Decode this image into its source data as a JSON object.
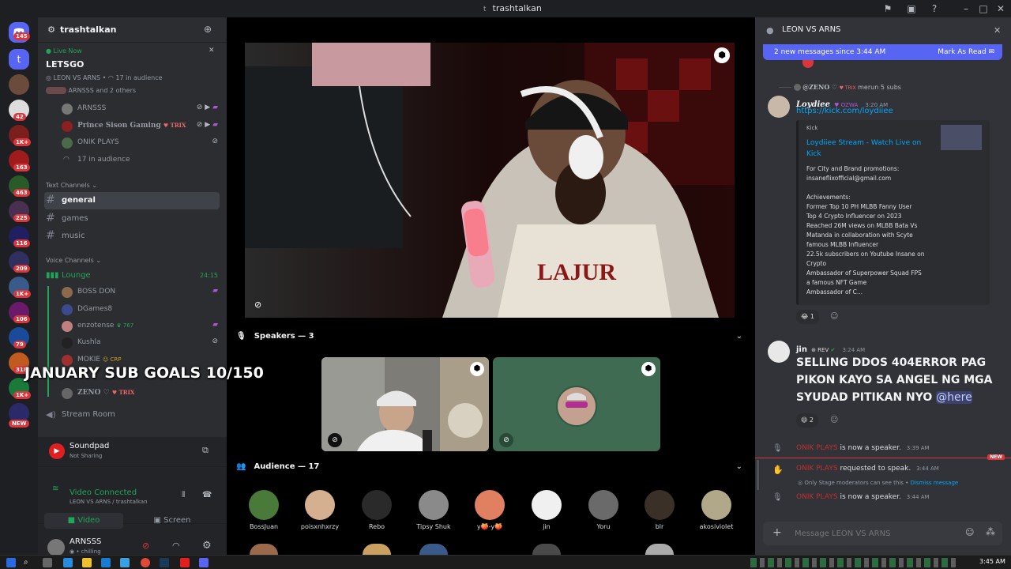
{
  "window": {
    "title": "trashtalkan",
    "title_icon": "t"
  },
  "rail": {
    "dm_badge": "145",
    "badges": [
      "42",
      "1K+",
      "163",
      "463",
      "225",
      "116",
      "209",
      "1K+",
      "106",
      "79",
      "318",
      "1K+"
    ],
    "new_label": "NEW"
  },
  "server": {
    "name": "trashtalkan",
    "live": {
      "live_label": "Live Now",
      "title": "LETSGO",
      "stage_name": "LEON VS ARNS",
      "audience": "17 in audience",
      "speakers_line": "ARNSSS and 2 others"
    },
    "stage_members": [
      {
        "name": "ARNSSS"
      },
      {
        "name": "Prince Sison Gaming",
        "tag": "TRIX"
      },
      {
        "name": "ONIK PLAYS"
      },
      {
        "name": "17 in audience"
      }
    ],
    "text_category": "Text Channels",
    "text_channels": [
      "general",
      "games",
      "music"
    ],
    "voice_category": "Voice Channels",
    "lounge": {
      "name": "Lounge",
      "timer": "24:15"
    },
    "lounge_members": [
      {
        "name": "BOSS DON"
      },
      {
        "name": "DGames8"
      },
      {
        "name": "enzotense",
        "tag": "767"
      },
      {
        "name": "Kushla"
      },
      {
        "name": "MOKIE",
        "tag": "CRP"
      },
      {
        "name": "ZENO",
        "tag": "TRIX"
      }
    ],
    "stream_room": "Stream Room",
    "overlay_goal": "JANUARY SUB GOALS 10/150"
  },
  "panel": {
    "soundpad_title": "Soundpad",
    "soundpad_status": "Not Sharing",
    "video_connected": "Video Connected",
    "video_sub": "LEON VS ARNS / trashtalkan",
    "video_btn": "Video",
    "screen_btn": "Screen",
    "user_name": "ARNSSS",
    "user_status": "chilling"
  },
  "stage": {
    "speakers_header": "Speakers — 3",
    "audience_header": "Audience — 17",
    "audience": [
      "BossJuan",
      "poisxnhxrzy",
      "Rebo",
      "Tipsy Shuk",
      "y🍑-y🍑",
      "jin",
      "Yoru",
      "blr",
      "akosiviolet"
    ]
  },
  "chat": {
    "title": "LEON VS ARNS",
    "new_messages": "2 new messages since 3:44 AM",
    "mark_read": "Mark As Read",
    "reply_ref": {
      "name": "@ZENO",
      "tag": "TRIX",
      "text": "merun 5 subs"
    },
    "msg1": {
      "author": "Loydiee",
      "tag": "OZWA",
      "time": "3:20 AM",
      "link": "https://kick.com/loydiiee",
      "embed_site": "Kick",
      "embed_title": "Loydiiee Stream - Watch Live on Kick",
      "embed_desc": [
        "For City and Brand promotions:",
        "insaneflixofficial@gmail.com",
        "",
        "Achievements:",
        "Former Top 10 PH MLBB Fanny User",
        "Top 4 Crypto Influencer on 2023",
        "Reached 26M views on MLBB Bata Vs",
        "Matanda in collaboration with Scyte",
        "famous MLBB Influencer",
        "22.5k subscribers on Youtube Insane on",
        "Crypto",
        "Ambassador of Superpower Squad FPS",
        "a famous NFT Game",
        "Ambassador of C..."
      ],
      "reaction_count": "1"
    },
    "msg2": {
      "author": "jin",
      "tag": "REV",
      "time": "3:24 AM",
      "text": "SELLING DDOS 404ERROR PAG PIKON KAYO SA ANGEL NG MGA SYUDAD PITIKAN NYO",
      "mention": "@here",
      "reaction_count": "2"
    },
    "sys1": {
      "who": "ONIK PLAYS",
      "text": "is now a speaker.",
      "time": "3:39 AM"
    },
    "sys2": {
      "who": "ONIK PLAYS",
      "text": "requested to speak.",
      "time": "3:44 AM",
      "note": "Only Stage moderators can see this •",
      "dismiss": "Dismiss message",
      "new_label": "NEW"
    },
    "sys3": {
      "who": "ONIK PLAYS",
      "text": "is now a speaker.",
      "time": "3:44 AM"
    },
    "compose_placeholder": "Message LEON VS ARNS"
  },
  "taskbar": {
    "time": "3:45 AM"
  }
}
